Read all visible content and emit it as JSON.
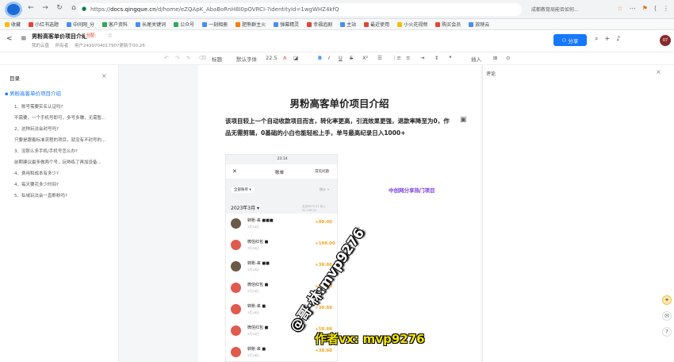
{
  "browser": {
    "url_prefix": "https://",
    "url_host": "docs.qingque.cn",
    "url_path": "/d/home/eZQApK_AbaBoRnH8I0pOVRCI-?identityId=1wgWHZ4kfQ",
    "right_text": "成都教育局能否如何…",
    "nav": [
      "←",
      "→",
      "↻",
      "⌂"
    ],
    "tools": [
      "☆",
      "⋯",
      "⚑",
      "⟨",
      "⋮"
    ]
  },
  "bookmarks": [
    {
      "label": "收藏",
      "color": "y"
    },
    {
      "label": "小红书选题",
      "color": "r"
    },
    {
      "label": "中间网_分",
      "color": "b"
    },
    {
      "label": "客户资料",
      "color": "g"
    },
    {
      "label": "长尾关键词",
      "color": "b"
    },
    {
      "label": "公众号",
      "color": "g"
    },
    {
      "label": "一刻相册",
      "color": "b"
    },
    {
      "label": "肥熊群主火",
      "color": "o"
    },
    {
      "label": "弹幕精灵",
      "color": "b"
    },
    {
      "label": "幸福追剧",
      "color": "r"
    },
    {
      "label": "主站",
      "color": "b"
    },
    {
      "label": "最近使用",
      "color": "r"
    },
    {
      "label": "小火花视频",
      "color": "y"
    },
    {
      "label": "购买会员",
      "color": "r"
    },
    {
      "label": "放映云",
      "color": "b"
    }
  ],
  "header": {
    "title": "男粉高客单价项目介绍",
    "tag": "分配",
    "location": "我的云盘",
    "owner": "所有者",
    "updated": "用户2439704017907更新于00:26",
    "share_label": "分享",
    "avatar_text": "07"
  },
  "toolbar": {
    "heading": "标题",
    "font": "默认字体",
    "size": "22.5",
    "bold": "B",
    "insert": "插入",
    "more": "更多"
  },
  "outline": {
    "title": "目录",
    "items": [
      {
        "text": "男粉高客单价项目介绍",
        "main": true
      },
      {
        "text": "1、账号需要实名认证吗?"
      },
      {
        "text": "不需要，一个手机号即可，多号多赚，无需暂..."
      },
      {
        "text": "2、这种玩法会封号吗?"
      },
      {
        "text": "只要是跟着标准流程的项目，就没有不封号的..."
      },
      {
        "text": "3、没那么多手机/手机号怎么办?"
      },
      {
        "text": "前期建议最多做两个号，玩熟练了再加设备..."
      },
      {
        "text": "4、费用和成本有多少?"
      },
      {
        "text": "4、每天要花多少时间?"
      },
      {
        "text": "5、私域玩法会一直断粉吗?"
      }
    ]
  },
  "doc": {
    "title": "男粉高客单价项目介绍",
    "paragraph": "该项目较上一个自动收款项目而言，转化率更高，引流效果更强，退款率降至为0，作品无需剪辑，0基础的小白也能轻松上手，单号最高纪录日入1000+",
    "link": "中创网分享热门项目"
  },
  "phone": {
    "status": "23:14",
    "title": "账单",
    "faq": "常见问题",
    "filter": "全部账单 ▾",
    "stat": "统计 >",
    "month": "2023年3月 ▾",
    "month_sub": "支出¥870.01 收入¥1,248.00",
    "rows": [
      {
        "name": "转账-来 ■■■",
        "date": "3月18日",
        "amount": "+88.00",
        "photo": true
      },
      {
        "name": "微信红包 ■",
        "date": "3月18日",
        "amount": "+198.00",
        "photo": false
      },
      {
        "name": "转账-来 ■■",
        "date": "3月18日",
        "amount": "+38.88",
        "photo": true
      },
      {
        "name": "微信红包 ■",
        "date": "3月18日",
        "amount": "+58.88",
        "photo": false
      },
      {
        "name": "转账-来 ■",
        "date": "3月18日",
        "amount": "+38.88",
        "photo": false
      },
      {
        "name": "微信红包 ■",
        "date": "3月18日",
        "amount": "+58.88",
        "photo": false
      },
      {
        "name": "转账-来 ■",
        "date": "3月18日",
        "amount": "+38.88",
        "photo": false
      }
    ]
  },
  "watermarks": {
    "diagonal": "@哥·林:mvp9276",
    "bottom": "作者vx: mvp9276"
  },
  "comments": {
    "title": "评论"
  }
}
